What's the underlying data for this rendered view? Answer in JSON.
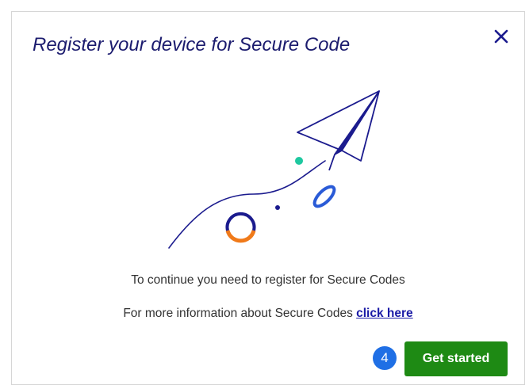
{
  "dialog": {
    "title": "Register your device for Secure Code",
    "close_icon": "close-icon",
    "illustration_icon": "paper-plane-icon",
    "message_line1": "To continue you need to register for Secure Codes",
    "message_line2_prefix": "For more information about Secure Codes ",
    "link_text": "click here",
    "step_badge": "4",
    "primary_button": "Get started"
  },
  "colors": {
    "title": "#1b1b6e",
    "accent_navy": "#1b1b8e",
    "accent_blue": "#2a5bd7",
    "accent_orange": "#f07a1a",
    "accent_teal": "#1ec8a0",
    "button_green": "#1e8a14",
    "badge_blue": "#1f6fe5"
  }
}
